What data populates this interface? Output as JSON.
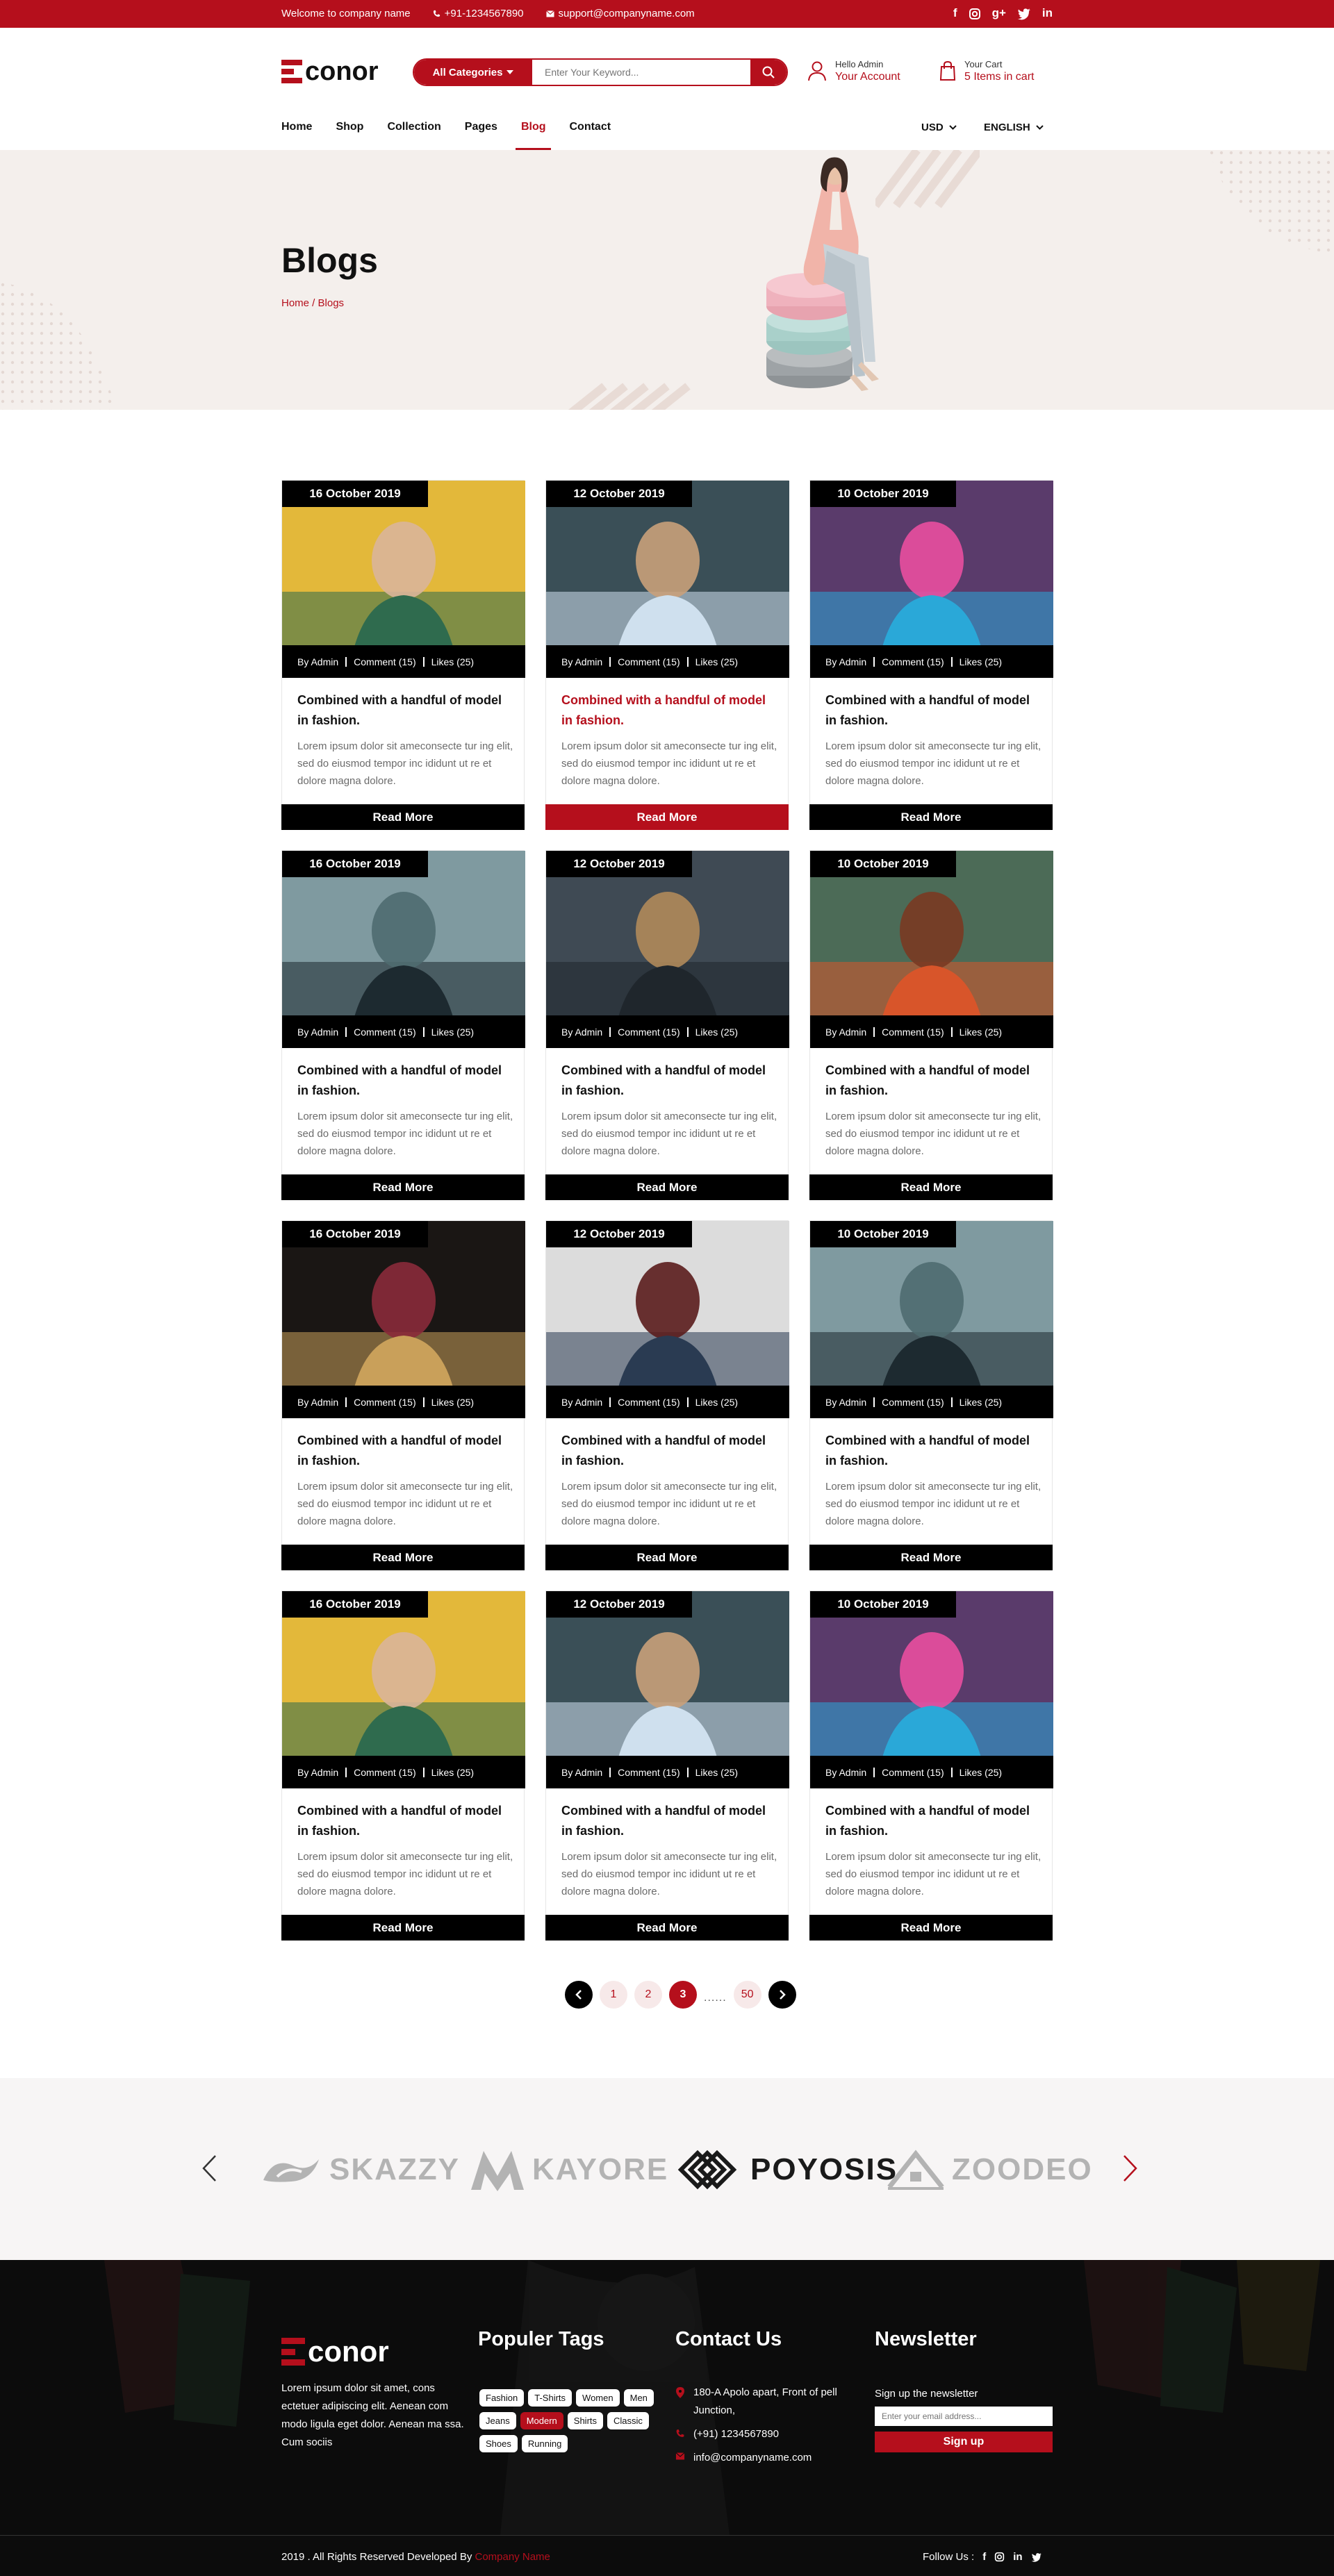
{
  "topbar": {
    "welcome": "Welcome to company name",
    "phone": "+91-1234567890",
    "email": "support@companyname.com",
    "social_icons": [
      "facebook-icon",
      "instagram-icon",
      "google-plus-icon",
      "twitter-icon",
      "linkedin-icon"
    ]
  },
  "header": {
    "logo": "conor",
    "search": {
      "category": "All Categories",
      "placeholder": "Enter Your Keyword..."
    },
    "account": {
      "greeting": "Hello Admin",
      "label": "Your Account"
    },
    "cart": {
      "label": "Your Cart",
      "count": "5 Items in cart"
    }
  },
  "nav": {
    "items": [
      "Home",
      "Shop",
      "Collection",
      "Pages",
      "Blog",
      "Contact"
    ],
    "active": "Blog",
    "currency": "USD",
    "language": "ENGLISH"
  },
  "hero": {
    "title": "Blogs",
    "breadcrumb": "Home / Blogs"
  },
  "blog": {
    "dates": [
      "16 October 2019",
      "12 October 2019",
      "10 October 2019"
    ],
    "meta": {
      "author": "By Admin",
      "comments": "Comment (15)",
      "likes": "Likes (25)"
    },
    "title": "Combined with a handful of model in fashion.",
    "excerpt": "Lorem ipsum dolor sit ameconsecte tur ing elit, sed do eiusmod tempor inc ididunt ut re et dolore magna dolore.",
    "read_more": "Read More",
    "highlighted_card": 2
  },
  "pagination": {
    "pages": [
      "1",
      "2",
      "3"
    ],
    "current": "3",
    "ellipsis": "......",
    "last": "50"
  },
  "brands": [
    "SKAZZY",
    "KAYORE",
    "POYOSIS",
    "ZOODEO"
  ],
  "footer": {
    "logo": "conor",
    "about": "Lorem ipsum dolor sit amet, cons ectetuer adipiscing elit. Aenean com modo ligula eget dolor. Aenean ma ssa. Cum sociis",
    "tags_title": "Populer Tags",
    "tags": [
      "Fashion",
      "T-Shirts",
      "Women",
      "Men",
      "Jeans",
      "Modern",
      "Shirts",
      "Classic",
      "Shoes",
      "Running"
    ],
    "active_tag": "Modern",
    "contact_title": "Contact Us",
    "address": "180-A Apolo apart, Front of pell Junction,",
    "phone": "(+91) 1234567890",
    "email": "info@companyname.com",
    "newsletter_title": "Newsletter",
    "newsletter_label": "Sign up the newsletter",
    "newsletter_placeholder": "Enter your email address...",
    "signup": "Sign up",
    "copyright": "2019 . All Rights Reserved Developed By",
    "company": "Company Name",
    "follow": "Follow Us :"
  },
  "colors": {
    "accent": "#b50f1c",
    "dark": "#000000",
    "hero_bg": "#f4efec"
  }
}
